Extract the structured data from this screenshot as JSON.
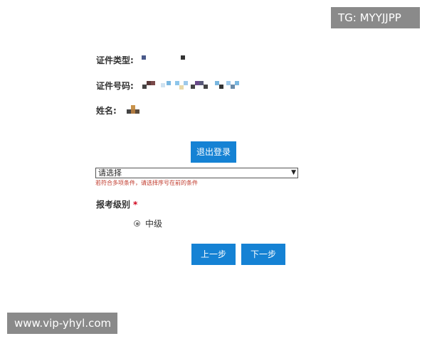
{
  "watermarks": {
    "top_right": "TG: MYYJJPP",
    "bottom_left": "www.vip-yhyl.com"
  },
  "form": {
    "id_type_label": "证件类型:",
    "id_number_label": "证件号码:",
    "name_label": "姓名:",
    "logout_button": "退出登录",
    "select": {
      "selected": "请选择"
    },
    "hint": "若符合多项条件，请选择序号在前的条件",
    "level_label": "报考级别",
    "required_mark": "*",
    "level_option": "中级",
    "prev_button": "上一步",
    "next_button": "下一步"
  },
  "colors": {
    "button": "#1582d4",
    "hint": "#c0392b",
    "required": "#d0021b",
    "watermark_bg": "#8a8a8a"
  }
}
